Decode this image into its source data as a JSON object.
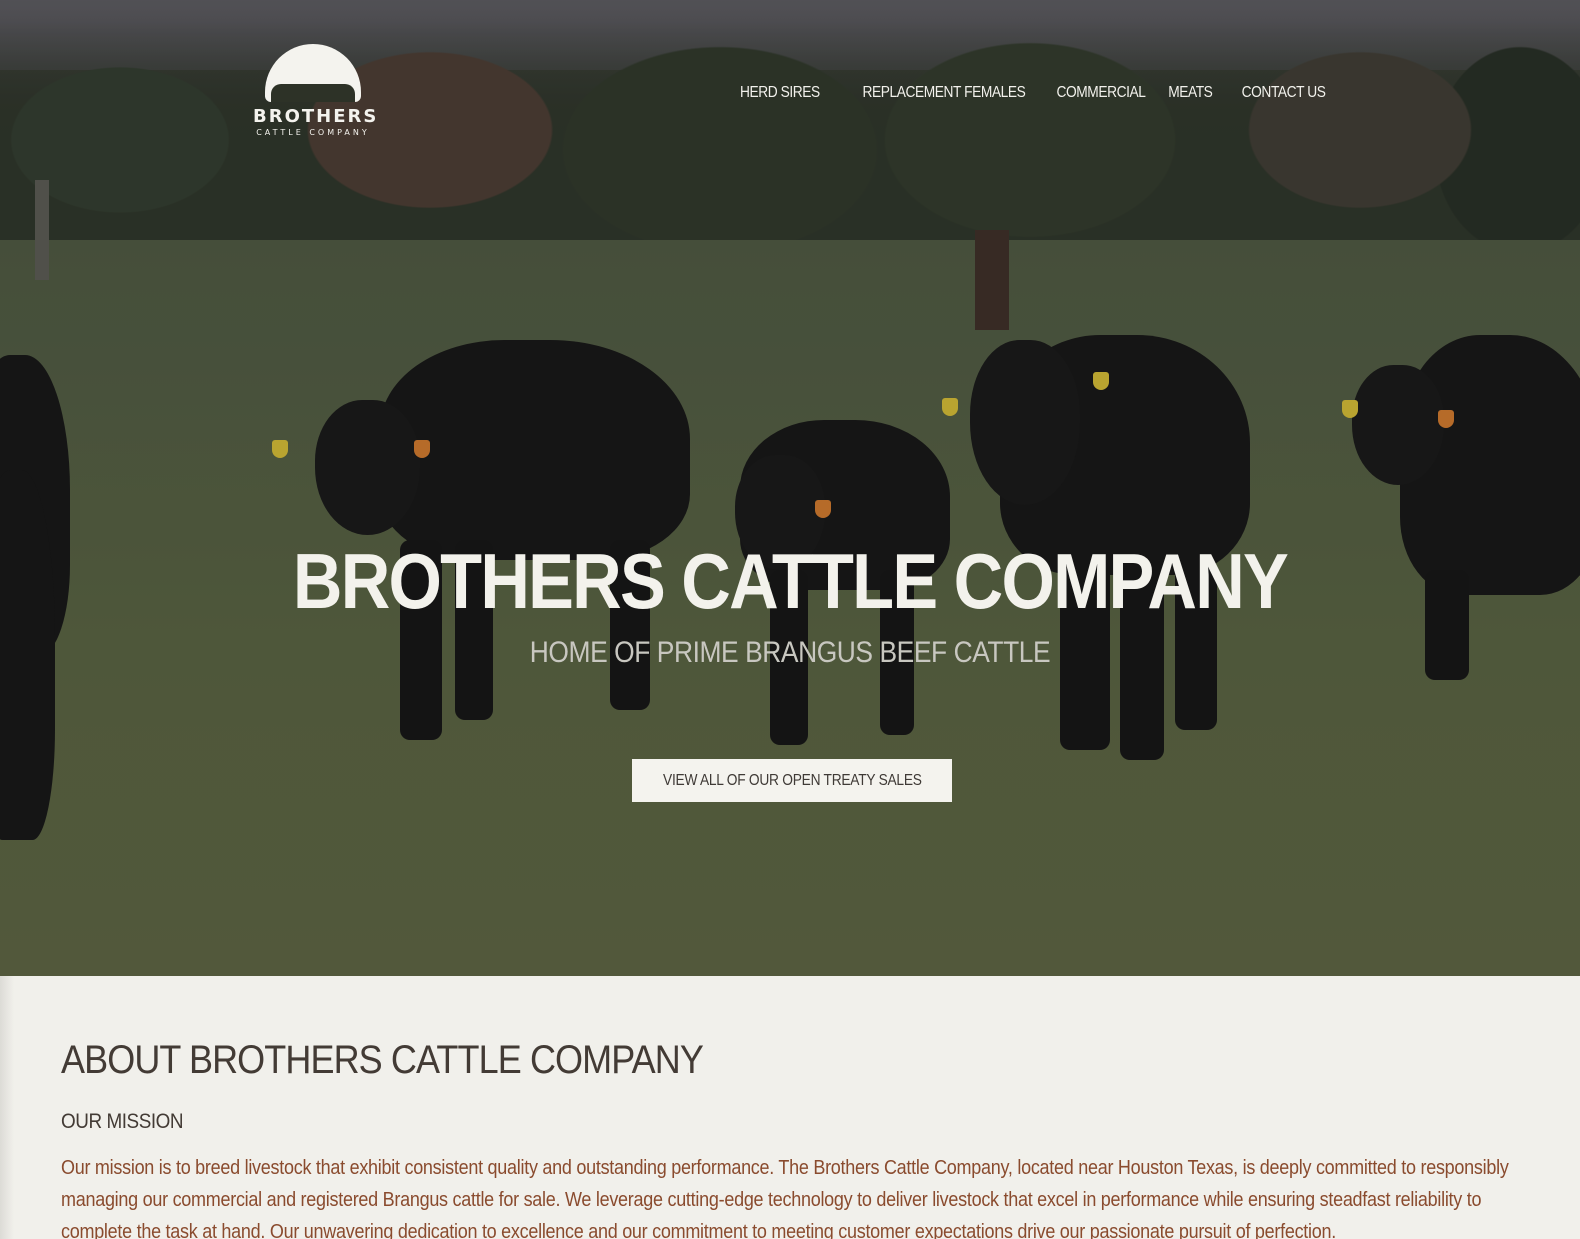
{
  "brand": {
    "logo_name": "BROTHERS",
    "logo_sub": "CATTLE COMPANY"
  },
  "nav": {
    "items": [
      {
        "label": "HERD SIRES"
      },
      {
        "label": "REPLACEMENT FEMALES"
      },
      {
        "label": "COMMERCIAL"
      },
      {
        "label": "MEATS"
      },
      {
        "label": "CONTACT US"
      }
    ]
  },
  "hero": {
    "title": "BROTHERS CATTLE COMPANY",
    "subtitle": "HOME OF PRIME BRANGUS BEEF CATTLE",
    "cta_label": "VIEW ALL OF OUR OPEN TREATY SALES"
  },
  "about": {
    "heading": "ABOUT BROTHERS CATTLE COMPANY",
    "subheading": "OUR MISSION",
    "body": "Our mission is to breed livestock that exhibit consistent quality and outstanding performance. The Brothers Cattle Company, located near Houston Texas, is deeply committed to responsibly managing our commercial and registered Brangus cattle for sale. We leverage cutting-edge technology to deliver livestock that excel in performance while ensuring steadfast reliability to complete the task at hand. Our unwavering dedication to excellence and our commitment to meeting customer expectations drive our passionate pursuit of perfection."
  },
  "colors": {
    "background": "#f1f0eb",
    "heading": "#433b35",
    "body_text": "#8a4b2e",
    "hero_text": "#f3f2ec"
  }
}
